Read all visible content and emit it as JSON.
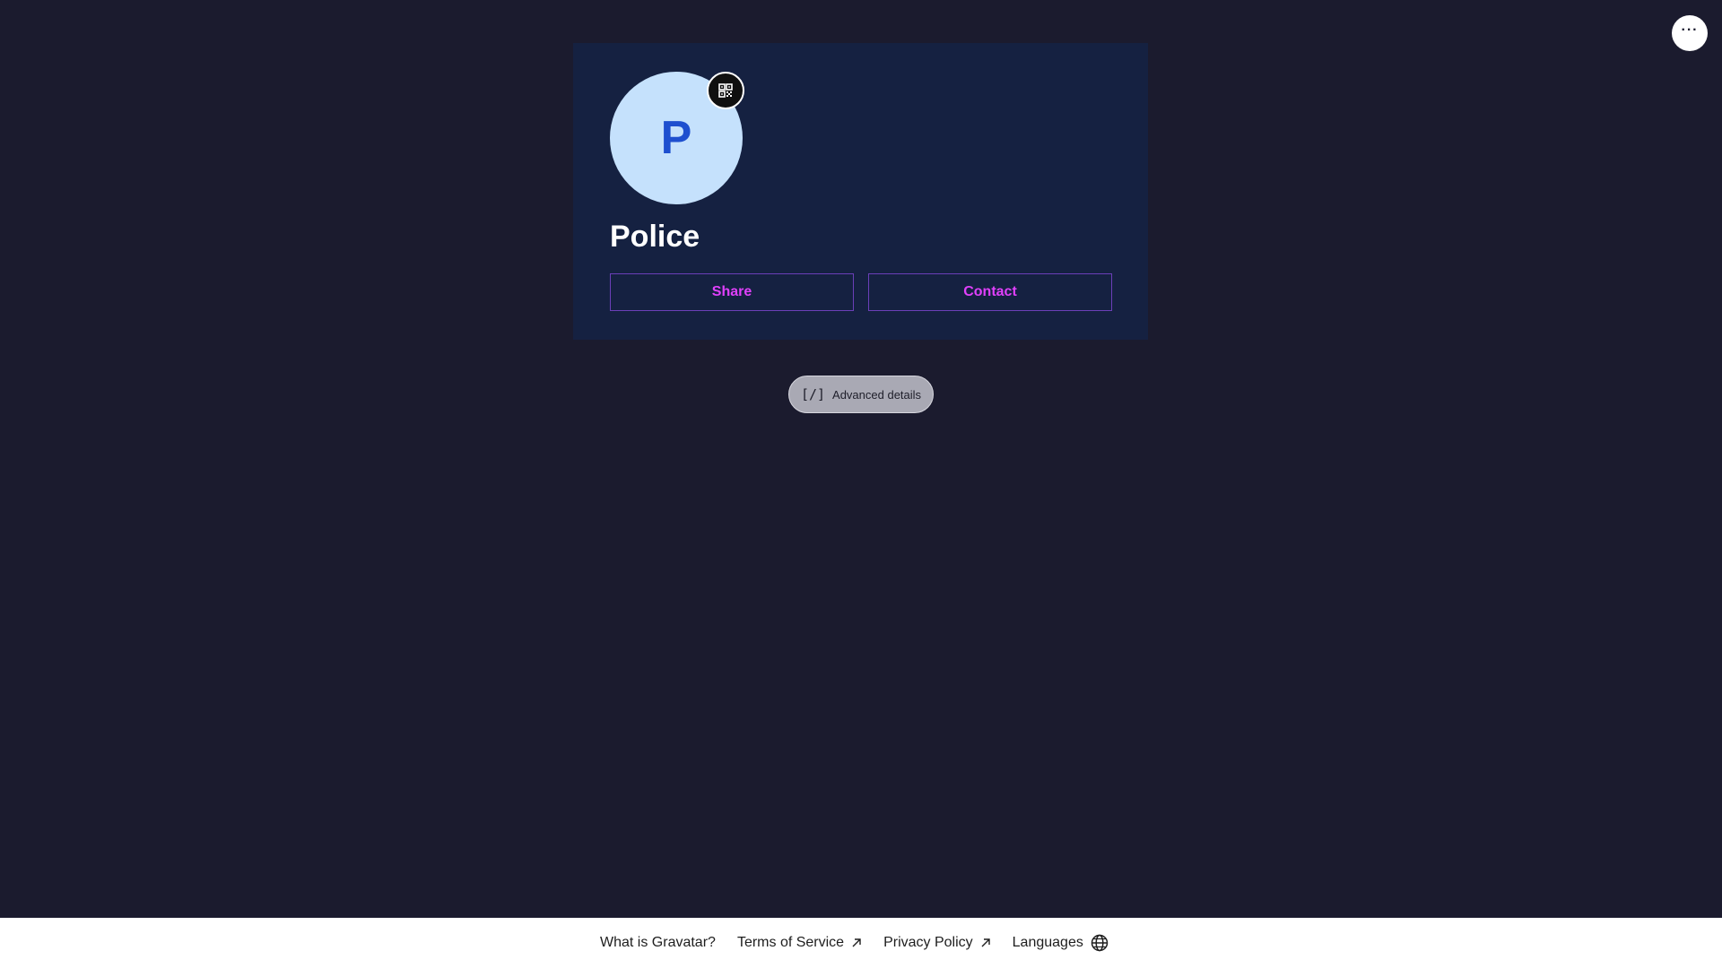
{
  "header": {
    "menu_label": "···"
  },
  "profile": {
    "avatar_letter": "P",
    "display_name": "Police",
    "share_label": "Share",
    "contact_label": "Contact",
    "qr_icon": "qr-code-icon"
  },
  "advanced": {
    "icon_text": "[/]",
    "label": "Advanced details"
  },
  "footer": {
    "links": [
      {
        "label": "What is Gravatar?",
        "icon": ""
      },
      {
        "label": "Terms of Service",
        "icon": "external-arrow-icon"
      },
      {
        "label": "Privacy Policy",
        "icon": "external-arrow-icon"
      },
      {
        "label": "Languages",
        "icon": "globe-icon"
      }
    ]
  },
  "colors": {
    "background": "#1b1b2e",
    "card": "#152141",
    "avatar_bg": "#c5e1fc",
    "avatar_letter": "#1e4fcf",
    "accent": "#e040fb"
  }
}
